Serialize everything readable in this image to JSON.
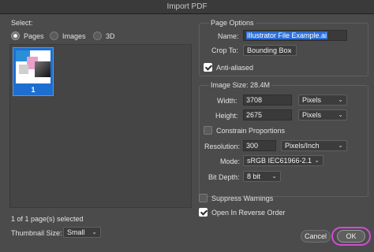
{
  "window": {
    "title": "Import PDF"
  },
  "select": {
    "label": "Select:",
    "options": [
      {
        "label": "Pages",
        "checked": true
      },
      {
        "label": "Images",
        "checked": false
      },
      {
        "label": "3D",
        "checked": false
      }
    ],
    "thumbnail": {
      "page_number": "1"
    },
    "status": "1 of 1 page(s) selected",
    "thumbnail_size_label": "Thumbnail Size:",
    "thumbnail_size_value": "Small"
  },
  "page_options": {
    "header": "Page Options",
    "name_label": "Name:",
    "name_value": "Illustrator File Example.ai",
    "crop_label": "Crop To:",
    "crop_value": "Bounding Box",
    "anti_aliased_label": "Anti-aliased",
    "anti_aliased_checked": true
  },
  "image_size": {
    "header": "Image Size: 28.4M",
    "width_label": "Width:",
    "width_value": "3708",
    "width_unit": "Pixels",
    "height_label": "Height:",
    "height_value": "2675",
    "height_unit": "Pixels",
    "constrain_label": "Constrain Proportions",
    "constrain_checked": false,
    "resolution_label": "Resolution:",
    "resolution_value": "300",
    "resolution_unit": "Pixels/Inch",
    "mode_label": "Mode:",
    "mode_value": "sRGB IEC61966-2.1",
    "bitdepth_label": "Bit Depth:",
    "bitdepth_value": "8 bit"
  },
  "options": {
    "suppress_label": "Suppress Warnings",
    "suppress_checked": false,
    "reverse_label": "Open In Reverse Order",
    "reverse_checked": true
  },
  "buttons": {
    "cancel": "Cancel",
    "ok": "OK"
  },
  "colors": {
    "accent": "#2d6fd6",
    "highlight": "#d64ad6",
    "dialog_bg": "#4b4b4b"
  }
}
